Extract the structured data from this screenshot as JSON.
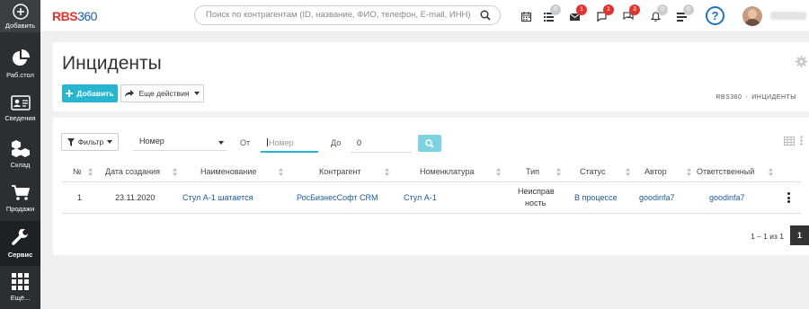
{
  "sidebar": {
    "add_label": "Добавить",
    "items": [
      {
        "label": "Раб.стол",
        "icon": "pie-chart-icon"
      },
      {
        "label": "Сведения",
        "icon": "id-card-icon"
      },
      {
        "label": "Склад",
        "icon": "boxes-icon"
      },
      {
        "label": "Продажи",
        "icon": "cart-icon"
      },
      {
        "label": "Сервис",
        "icon": "wrench-icon"
      },
      {
        "label": "Ещё...",
        "icon": "grid-icon"
      }
    ]
  },
  "topbar": {
    "logo_rbs": "RBS",
    "logo_num": "360",
    "search_placeholder": "Поиск по контрагентам (ID, название, ФИО, телефон, E-mail, ИНН)",
    "badges": {
      "tasks": "0",
      "mail": "1",
      "chat": "1",
      "comments": "3",
      "notifications": "0",
      "news": "0"
    },
    "help_label": "?"
  },
  "header": {
    "title": "Инциденты",
    "add_button": "Добавить",
    "more_button": "Еще действия",
    "breadcrumb": [
      "RBS360",
      "ИНЦИДЕНТЫ"
    ]
  },
  "filter": {
    "filter_button": "Фильтр",
    "field_select": "Номер",
    "from_label": "От",
    "from_placeholder": "Номер",
    "to_label": "До",
    "to_value": "0"
  },
  "table": {
    "columns": [
      "№",
      "Дата создания",
      "Наименование",
      "Контрагент",
      "Номенклатура",
      "Тип",
      "Статус",
      "Автор",
      "Ответственный"
    ],
    "rows": [
      {
        "num": "1",
        "date": "23.11.2020",
        "name": "Стул А-1 шатается",
        "counterparty": "РосБизнесСофт CRM",
        "nomenclature": "Стул А-1",
        "type_line1": "Неисправ",
        "type_line2": "ность",
        "status": "В процессе",
        "author": "goodinfa7",
        "responsible": "goodinfa7"
      }
    ]
  },
  "pagination": {
    "range_text": "1 – 1 из 1",
    "current_page": "1"
  },
  "colors": {
    "accent": "#27b6d0",
    "sidebar_bg": "#2b2f33",
    "badge_red": "#e2342d",
    "link_blue": "#1a5a99"
  }
}
